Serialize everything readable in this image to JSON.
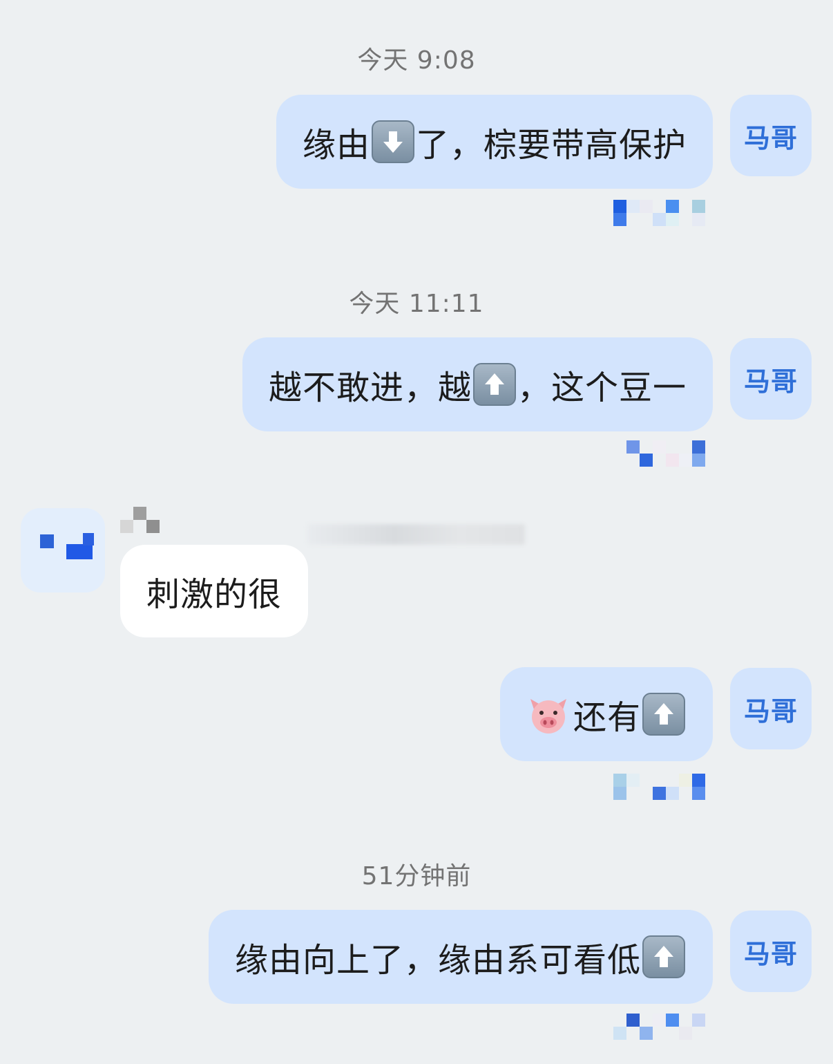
{
  "contact": {
    "self_avatar_label": "马哥"
  },
  "colors": {
    "background": "#edf0f2",
    "my_bubble": "#d3e4fd",
    "other_bubble": "#ffffff",
    "avatar_text": "#2f6fd8"
  },
  "messages": [
    {
      "timestamp": "今天 9:08",
      "side": "right",
      "text_parts": [
        "缘由",
        "[down-arrow-emoji]",
        "了，棕要带高保护"
      ]
    },
    {
      "timestamp": "今天 11:11",
      "side": "right",
      "text_parts": [
        "越不敢进，越",
        "[up-arrow-emoji]",
        "，这个豆一"
      ]
    },
    {
      "side": "left",
      "text": "刺激的很"
    },
    {
      "side": "right",
      "text_parts": [
        "[pig-emoji]",
        "还有",
        "[up-arrow-emoji]"
      ]
    },
    {
      "timestamp": "51分钟前",
      "side": "right",
      "text_parts": [
        "缘由向上了，缘由系可看低",
        "[up-arrow-emoji]"
      ]
    }
  ],
  "msg1": {
    "ts": "今天 9:08",
    "a": "缘由",
    "b": "了，棕要带高保护"
  },
  "msg2": {
    "ts": "今天 11:11",
    "a": "越不敢进，越",
    "b": "，这个豆一"
  },
  "msg3": {
    "text": "刺激的很"
  },
  "msg4": {
    "a": "还有"
  },
  "msg5": {
    "ts": "51分钟前",
    "a": "缘由向上了，缘由系可看低"
  }
}
